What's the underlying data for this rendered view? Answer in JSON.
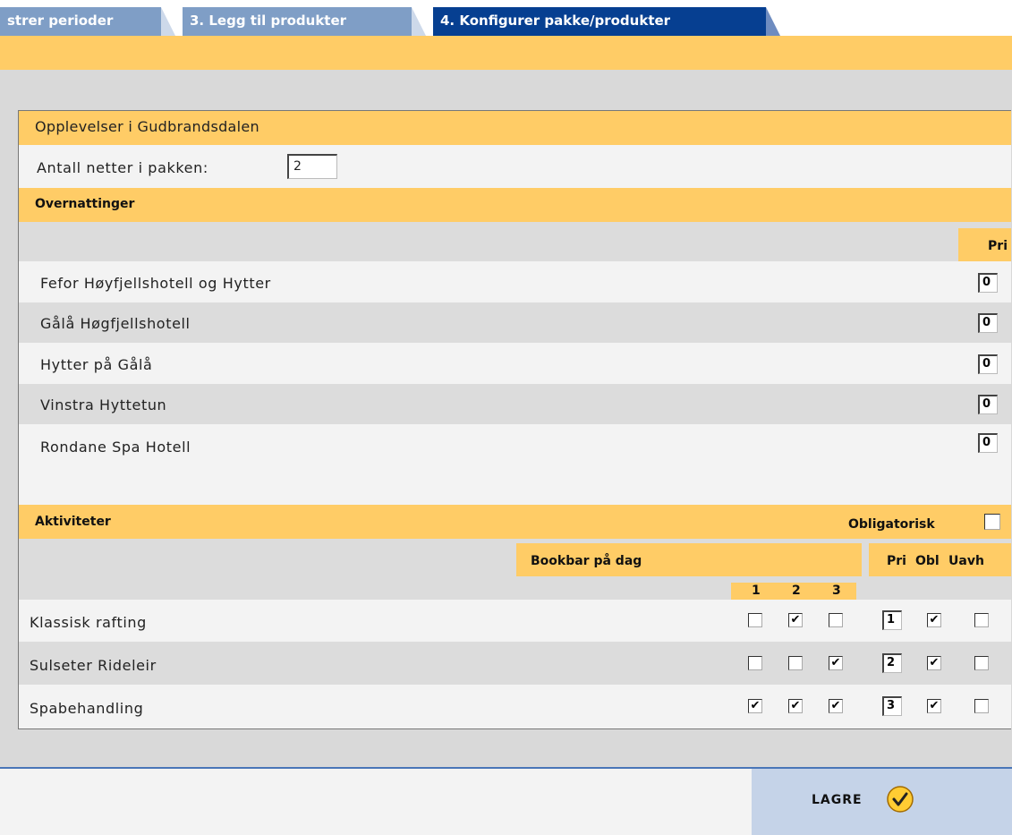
{
  "tabs": [
    {
      "label": "strer perioder"
    },
    {
      "label": "3. Legg til produkter"
    },
    {
      "label": "4. Konfigurer pakke/produkter"
    }
  ],
  "package": {
    "title": "Opplevelser i Gudbrandsdalen",
    "nights_label": "Antall netter i pakken:",
    "nights_value": "2"
  },
  "accommodations": {
    "heading": "Overnattinger",
    "pri_header": "Pri",
    "rows": [
      {
        "name": "Fefor Høyfjellshotell og Hytter",
        "pri": "0"
      },
      {
        "name": "Gålå Høgfjellshotell",
        "pri": "0"
      },
      {
        "name": "Hytter på Gålå",
        "pri": "0"
      },
      {
        "name": "Vinstra Hyttetun",
        "pri": "0"
      },
      {
        "name": "Rondane Spa Hotell",
        "pri": "0"
      }
    ]
  },
  "activities": {
    "heading": "Aktiviteter",
    "mandatory_label": "Obligatorisk",
    "mandatory_checked": false,
    "bookable_header": "Bookbar på dag",
    "days": [
      "1",
      "2",
      "3"
    ],
    "col_pri": "Pri",
    "col_obl": "Obl",
    "col_uavh": "Uavh",
    "rows": [
      {
        "name": "Klassisk rafting",
        "days": [
          false,
          true,
          false
        ],
        "pri": "1",
        "obl": true,
        "uavh": false
      },
      {
        "name": "Sulseter Rideleir",
        "days": [
          false,
          false,
          true
        ],
        "pri": "2",
        "obl": true,
        "uavh": false
      },
      {
        "name": "Spabehandling",
        "days": [
          true,
          true,
          true
        ],
        "pri": "3",
        "obl": true,
        "uavh": false
      }
    ]
  },
  "footer": {
    "save_label": "LAGRE",
    "save_icon": "checkmark-circle-icon"
  },
  "colors": {
    "tab": "#7f9ec6",
    "tab_active": "#063f91",
    "header_yellow": "#ffcc66",
    "row_grey": "#dcdcdc",
    "footer_blue": "#c5d3e8",
    "footer_line": "#4a76b8"
  }
}
